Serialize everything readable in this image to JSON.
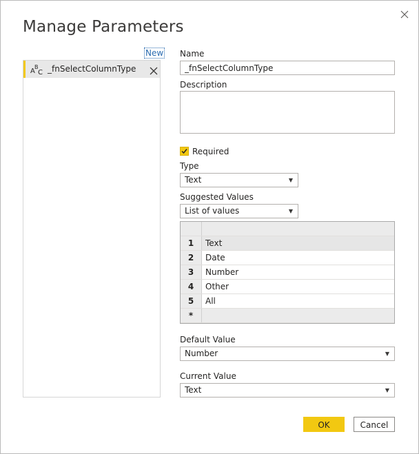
{
  "dialog": {
    "title": "Manage Parameters",
    "close_icon": "close-icon"
  },
  "sidebar": {
    "new_label": "New",
    "items": [
      {
        "icon": "abc-text-type-icon",
        "name": "_fnSelectColumnType"
      }
    ]
  },
  "form": {
    "name_label": "Name",
    "name_value": "_fnSelectColumnType",
    "description_label": "Description",
    "description_value": "",
    "required_label": "Required",
    "required_checked": true,
    "type_label": "Type",
    "type_value": "Text",
    "suggested_values_label": "Suggested Values",
    "suggested_values_value": "List of values",
    "values_list": [
      {
        "index": "1",
        "value": "Text"
      },
      {
        "index": "2",
        "value": "Date"
      },
      {
        "index": "3",
        "value": "Number"
      },
      {
        "index": "4",
        "value": "Other"
      },
      {
        "index": "5",
        "value": "All"
      }
    ],
    "new_row_marker": "*",
    "default_value_label": "Default Value",
    "default_value": "Number",
    "current_value_label": "Current Value",
    "current_value": "Text"
  },
  "buttons": {
    "ok_label": "OK",
    "cancel_label": "Cancel"
  },
  "colors": {
    "accent": "#f2c811",
    "link": "#2b6cb0"
  }
}
